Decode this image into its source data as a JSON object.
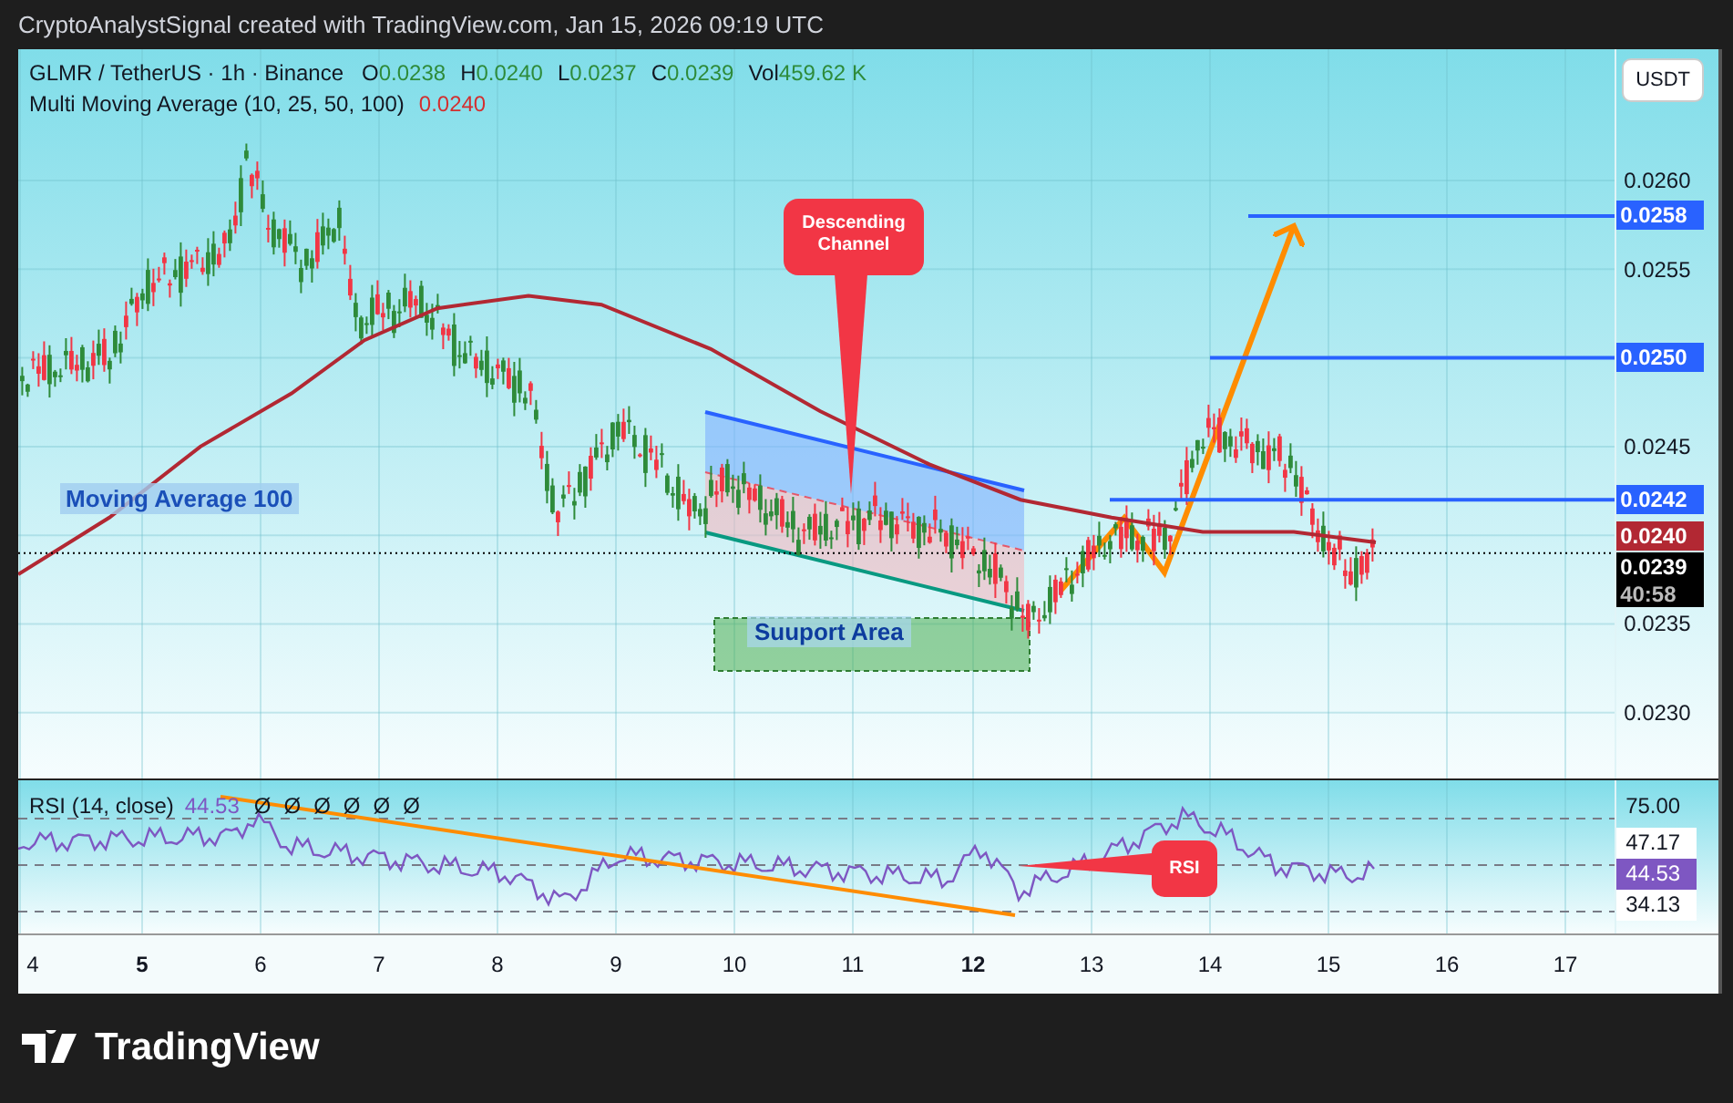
{
  "attribution": "CryptoAnalystSignal created with TradingView.com, Jan 15, 2026 09:19 UTC",
  "legend": {
    "symbol": "GLMR / TetherUS · 1h · Binance",
    "ohlc": [
      {
        "label": "O",
        "value": "0.0238"
      },
      {
        "label": "H",
        "value": "0.0240"
      },
      {
        "label": "L",
        "value": "0.0237"
      },
      {
        "label": "C",
        "value": "0.0239"
      }
    ],
    "volume": {
      "label": "Vol",
      "value": "459.62 K"
    }
  },
  "indicator": {
    "name": "Multi Moving Average (10, 25, 50, 100)",
    "value": "0.0240"
  },
  "currency_button": "USDT",
  "price_axis": [
    {
      "kind": "tick",
      "value": "0.0260"
    },
    {
      "kind": "line",
      "value": "0.0258",
      "color": "#2962ff"
    },
    {
      "kind": "tick",
      "value": "0.0255"
    },
    {
      "kind": "line",
      "value": "0.0250",
      "color": "#2962ff"
    },
    {
      "kind": "tick",
      "value": "0.0245"
    },
    {
      "kind": "line",
      "value": "0.0242",
      "color": "#2962ff"
    },
    {
      "kind": "line",
      "value": "0.0240",
      "color": "#b22833"
    },
    {
      "kind": "last",
      "value": "0.0239",
      "countdown": "40:58",
      "color": "#000000"
    },
    {
      "kind": "tick",
      "value": "0.0235"
    },
    {
      "kind": "tick",
      "value": "0.0230"
    }
  ],
  "annotations": {
    "channel_callout": "Descending Channel",
    "support_label": "Suuport Area",
    "ma_label": "Moving Average 100",
    "rsi_callout": "RSI"
  },
  "rsi": {
    "title": "RSI (14, close)",
    "value": "44.53",
    "markers": [
      "Ø",
      "Ø",
      "Ø",
      "Ø",
      "Ø",
      "Ø"
    ],
    "axis": [
      {
        "kind": "tick",
        "value": "75.00"
      },
      {
        "kind": "badge",
        "value": "47.17"
      },
      {
        "kind": "current",
        "value": "44.53"
      },
      {
        "kind": "badge",
        "value": "34.13"
      }
    ]
  },
  "time_axis": [
    {
      "label": "4",
      "emphasized": false
    },
    {
      "label": "5",
      "emphasized": true
    },
    {
      "label": "6",
      "emphasized": false
    },
    {
      "label": "7",
      "emphasized": false
    },
    {
      "label": "8",
      "emphasized": false
    },
    {
      "label": "9",
      "emphasized": false
    },
    {
      "label": "10",
      "emphasized": false
    },
    {
      "label": "11",
      "emphasized": false
    },
    {
      "label": "12",
      "emphasized": true
    },
    {
      "label": "13",
      "emphasized": false
    },
    {
      "label": "14",
      "emphasized": false
    },
    {
      "label": "15",
      "emphasized": false
    },
    {
      "label": "16",
      "emphasized": false
    },
    {
      "label": "17",
      "emphasized": false
    }
  ],
  "footer": {
    "brand": "TradingView"
  }
}
